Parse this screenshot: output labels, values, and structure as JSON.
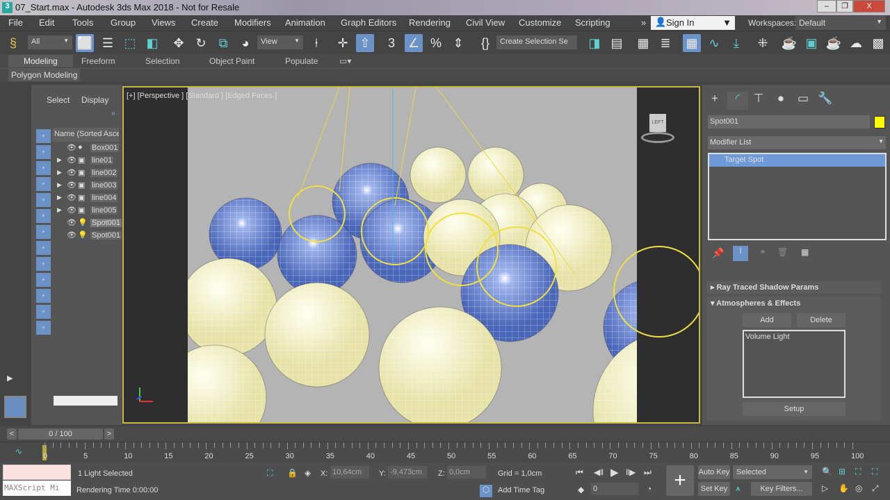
{
  "window": {
    "title": "07_Start.max - Autodesk 3ds Max 2018 - Not for Resale",
    "app_icon": "3",
    "minimize": "‒",
    "restore": "❐",
    "close": "X"
  },
  "menu": [
    "File",
    "Edit",
    "Tools",
    "Group",
    "Views",
    "Create",
    "Modifiers",
    "Animation",
    "Graph Editors",
    "Rendering",
    "Civil View",
    "Customize",
    "Scripting"
  ],
  "menu_overflow": "»",
  "signin": "Sign In",
  "workspaces_label": "Workspaces:",
  "workspace": "Default",
  "toolbar": {
    "filter": "All",
    "ref_coord": "View",
    "named_selection": "Create Selection Se"
  },
  "ribbon": {
    "tabs": [
      "Modeling",
      "Freeform",
      "Selection",
      "Object Paint",
      "Populate"
    ],
    "active": "Modeling",
    "panel": "Polygon Modeling"
  },
  "explorer": {
    "tabs": [
      "Select",
      "Display"
    ],
    "column": "Name (Sorted Asce",
    "items": [
      {
        "name": "Box001",
        "type": "geometry",
        "expandable": false
      },
      {
        "name": "line01",
        "type": "shape",
        "expandable": true
      },
      {
        "name": "line002",
        "type": "shape",
        "expandable": true
      },
      {
        "name": "line003",
        "type": "shape",
        "expandable": true
      },
      {
        "name": "line004",
        "type": "shape",
        "expandable": true
      },
      {
        "name": "line005",
        "type": "shape",
        "expandable": true
      },
      {
        "name": "Spot001",
        "type": "light",
        "expandable": false,
        "selected": true
      },
      {
        "name": "Spot001",
        "type": "light",
        "expandable": false
      }
    ]
  },
  "viewport": {
    "label": "[+] [Perspective ] [Standard ] [Edged Faces ]",
    "viewcube": "LEFT"
  },
  "command_panel": {
    "object_name": "Spot001",
    "object_color": "#ffff00",
    "modifier_list": "Modifier List",
    "stack": [
      "Target Spot"
    ],
    "rollouts": [
      {
        "title": "Ray Traced Shadow Params",
        "expanded": false
      },
      {
        "title": "Atmospheres & Effects",
        "expanded": true
      }
    ],
    "add": "Add",
    "delete": "Delete",
    "effects": [
      "Volume Light"
    ],
    "setup": "Setup"
  },
  "timeline": {
    "frame": "0 / 100",
    "prev": "<",
    "next": ">",
    "ticks": [
      "0",
      "5",
      "10",
      "15",
      "20",
      "25",
      "30",
      "35",
      "40",
      "45",
      "50",
      "55",
      "60",
      "65",
      "70",
      "75",
      "80",
      "85",
      "90",
      "95",
      "100"
    ]
  },
  "status": {
    "maxscript": "MAXScript Mi",
    "selection": "1 Light Selected",
    "render_time": "Rendering Time  0:00:00",
    "x_label": "X:",
    "x": "10,64cm",
    "y_label": "Y:",
    "y": "-9,473cm",
    "z_label": "Z:",
    "z": "0,0cm",
    "grid": "Grid = 1,0cm",
    "add_time_tag": "Add Time Tag",
    "auto_key": "Auto Key",
    "set_key": "Set Key",
    "key_mode": "Selected",
    "key_filters": "Key Filters...",
    "frame": "0"
  }
}
